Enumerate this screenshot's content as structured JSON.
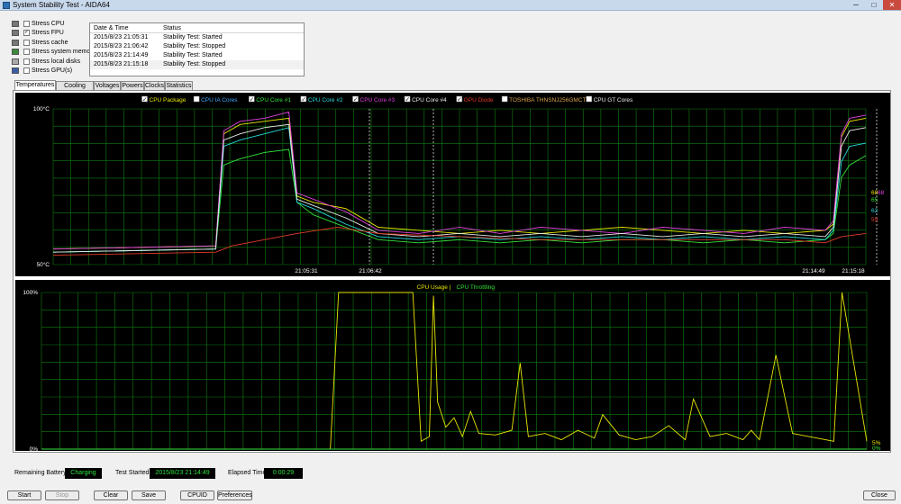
{
  "window": {
    "title": "System Stability Test - AIDA64",
    "min": "─",
    "max": "□",
    "close": "✕"
  },
  "stress_options": [
    {
      "label": "Stress CPU",
      "checked": false,
      "icon": "cpu-icon"
    },
    {
      "label": "Stress FPU",
      "checked": true,
      "icon": "fpu-icon"
    },
    {
      "label": "Stress cache",
      "checked": false,
      "icon": "cache-icon"
    },
    {
      "label": "Stress system memory",
      "checked": false,
      "icon": "memory-icon"
    },
    {
      "label": "Stress local disks",
      "checked": false,
      "icon": "disk-icon"
    },
    {
      "label": "Stress GPU(s)",
      "checked": false,
      "icon": "gpu-icon"
    }
  ],
  "log": {
    "headers": {
      "date": "Date & Time",
      "status": "Status"
    },
    "rows": [
      {
        "date": "2015/8/23 21:05:31",
        "status": "Stability Test: Started"
      },
      {
        "date": "2015/8/23 21:06:42",
        "status": "Stability Test: Stopped"
      },
      {
        "date": "2015/8/23 21:14:49",
        "status": "Stability Test: Started"
      },
      {
        "date": "2015/8/23 21:15:18",
        "status": "Stability Test: Stopped"
      }
    ]
  },
  "tabs": [
    "Temperatures",
    "Cooling Fans",
    "Voltages",
    "Powers",
    "Clocks",
    "Statistics"
  ],
  "active_tab": "Temperatures",
  "chart_data": [
    {
      "type": "line",
      "title": "",
      "ylim": [
        50,
        100
      ],
      "ylabel_top": "100°C",
      "ylabel_bottom": "50°C",
      "x_ticks": [
        "21:05:31",
        "21:06:42",
        "21:14:49",
        "21:15:18"
      ],
      "legend": [
        {
          "name": "CPU Package",
          "checked": true,
          "color": "#e6e600"
        },
        {
          "name": "CPU IA Cores",
          "checked": false,
          "color": "#3fa8ff"
        },
        {
          "name": "CPU Core #1",
          "checked": true,
          "color": "#34e23a"
        },
        {
          "name": "CPU Core #2",
          "checked": true,
          "color": "#27d9d9"
        },
        {
          "name": "CPU Core #3",
          "checked": true,
          "color": "#e040e0"
        },
        {
          "name": "CPU Core #4",
          "checked": true,
          "color": "#e8e8e8"
        },
        {
          "name": "GPU Diode",
          "checked": true,
          "color": "#e23a2a"
        },
        {
          "name": "TOSHIBA THNSNJ256GMCT",
          "checked": false,
          "color": "#d8a24a"
        },
        {
          "name": "CPU GT Cores",
          "checked": false,
          "color": "#e8e8e8"
        }
      ],
      "end_labels": [
        {
          "text": "68",
          "color": "#e6e600"
        },
        {
          "text": "68",
          "color": "#e040e0"
        },
        {
          "text": "65",
          "color": "#34e23a"
        },
        {
          "text": "62",
          "color": "#27d9d9"
        },
        {
          "text": "59",
          "color": "#e23a2a"
        }
      ],
      "series": [
        {
          "name": "CPU Package",
          "color": "#e6e600",
          "x": [
            0,
            20,
            21,
            23,
            26,
            29,
            30,
            32,
            36,
            40,
            45,
            50,
            55,
            60,
            65,
            70,
            75,
            80,
            85,
            90,
            95,
            96,
            97,
            98,
            100
          ],
          "values": [
            55,
            56,
            92,
            95,
            96,
            97,
            72,
            70,
            68,
            62,
            61,
            60,
            61,
            60,
            61,
            62,
            61,
            60,
            61,
            60,
            61,
            63,
            91,
            96,
            97
          ]
        },
        {
          "name": "CPU Core #1",
          "color": "#34e23a",
          "x": [
            0,
            20,
            21,
            23,
            26,
            29,
            30,
            32,
            36,
            40,
            45,
            50,
            55,
            60,
            65,
            70,
            75,
            80,
            85,
            90,
            95,
            96,
            97,
            98,
            100
          ],
          "values": [
            54,
            55,
            82,
            84,
            86,
            87,
            70,
            66,
            62,
            58,
            57,
            58,
            57,
            58,
            57,
            58,
            58,
            57,
            58,
            57,
            58,
            60,
            78,
            82,
            85
          ]
        },
        {
          "name": "CPU Core #2",
          "color": "#27d9d9",
          "x": [
            0,
            20,
            21,
            23,
            26,
            29,
            30,
            32,
            36,
            40,
            45,
            50,
            55,
            60,
            65,
            70,
            75,
            80,
            85,
            90,
            95,
            96,
            97,
            98,
            100
          ],
          "values": [
            54,
            55,
            88,
            90,
            92,
            94,
            70,
            68,
            63,
            59,
            58,
            59,
            58,
            59,
            58,
            59,
            58,
            59,
            58,
            59,
            58,
            61,
            83,
            88,
            89
          ]
        },
        {
          "name": "CPU Core #3",
          "color": "#e040e0",
          "x": [
            0,
            20,
            21,
            23,
            26,
            29,
            30,
            32,
            36,
            40,
            45,
            50,
            55,
            60,
            65,
            70,
            75,
            80,
            85,
            90,
            95,
            96,
            97,
            98,
            100
          ],
          "values": [
            55,
            56,
            93,
            96,
            97,
            99,
            73,
            71,
            67,
            61,
            60,
            62,
            60,
            62,
            61,
            60,
            62,
            61,
            60,
            62,
            61,
            64,
            92,
            97,
            98
          ]
        },
        {
          "name": "CPU Core #4",
          "color": "#e8e8e8",
          "x": [
            0,
            20,
            21,
            23,
            26,
            29,
            30,
            32,
            36,
            40,
            45,
            50,
            55,
            60,
            65,
            70,
            75,
            80,
            85,
            90,
            95,
            96,
            97,
            98,
            100
          ],
          "values": [
            54,
            55,
            90,
            92,
            94,
            95,
            71,
            69,
            65,
            60,
            59,
            60,
            59,
            60,
            59,
            60,
            59,
            60,
            59,
            60,
            59,
            62,
            88,
            93,
            94
          ]
        },
        {
          "name": "GPU Diode",
          "color": "#e23a2a",
          "x": [
            0,
            20,
            22,
            26,
            30,
            35,
            40,
            50,
            60,
            70,
            80,
            90,
            95,
            97,
            100
          ],
          "values": [
            53,
            54,
            56,
            58,
            60,
            62,
            60,
            59,
            58,
            58,
            58,
            58,
            57,
            59,
            60
          ]
        }
      ]
    },
    {
      "type": "line",
      "title": "",
      "ylim": [
        0,
        100
      ],
      "ylabel_top": "100%",
      "ylabel_bottom": "0%",
      "legend": [
        {
          "name": "CPU Usage",
          "color": "#e6e600"
        },
        {
          "name": "|",
          "color": "#e6e600"
        },
        {
          "name": "CPU Throttling",
          "color": "#34e23a"
        }
      ],
      "end_labels": [
        {
          "text": "5%",
          "color": "#e6e600"
        },
        {
          "text": "0%",
          "color": "#34e23a"
        }
      ],
      "series": [
        {
          "name": "CPU Usage",
          "color": "#e6e600",
          "x": [
            0,
            35,
            36,
            44,
            45,
            46,
            47,
            47.5,
            48,
            49,
            50,
            51,
            52,
            53,
            55,
            57,
            58,
            59,
            61,
            63,
            65,
            67,
            68,
            70,
            72,
            74,
            76,
            78,
            79,
            81,
            83,
            85,
            86,
            87,
            89,
            91,
            93,
            95,
            96,
            97,
            100
          ],
          "values": [
            0,
            0,
            100,
            100,
            100,
            5,
            8,
            98,
            30,
            14,
            20,
            8,
            24,
            10,
            9,
            12,
            55,
            8,
            10,
            6,
            12,
            7,
            22,
            9,
            6,
            8,
            15,
            6,
            32,
            8,
            10,
            6,
            12,
            6,
            60,
            10,
            8,
            6,
            5,
            100,
            5
          ]
        },
        {
          "name": "CPU Throttling",
          "color": "#34e23a",
          "x": [
            0,
            100
          ],
          "values": [
            0,
            0
          ]
        }
      ]
    }
  ],
  "status": {
    "battery_label": "Remaining Battery:",
    "battery_value": "Charging",
    "started_label": "Test Started:",
    "started_value": "2015/8/23 21:14:49",
    "elapsed_label": "Elapsed Time:",
    "elapsed_value": "0:00:29"
  },
  "buttons": {
    "start": "Start",
    "stop": "Stop",
    "clear": "Clear",
    "save": "Save",
    "cpuid": "CPUID",
    "preferences": "Preferences",
    "close": "Close"
  }
}
